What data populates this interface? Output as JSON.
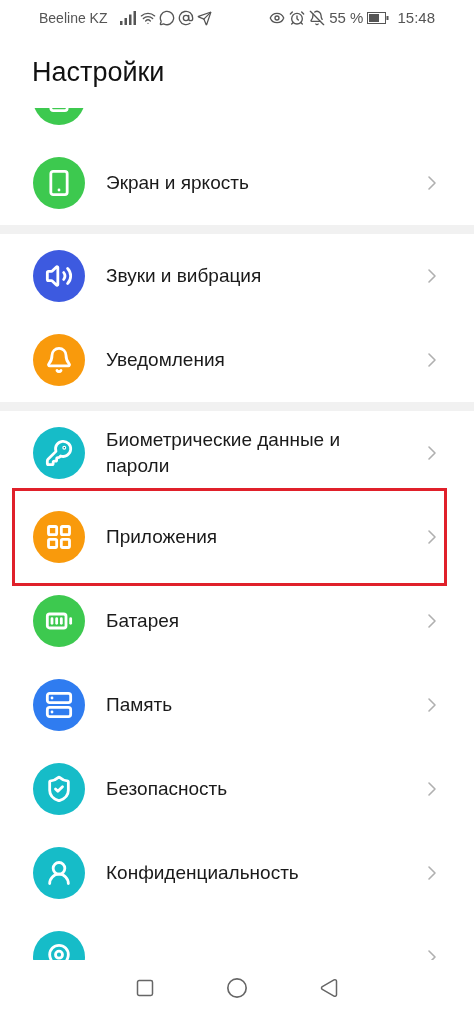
{
  "status_bar": {
    "carrier": "Beeline KZ",
    "battery": "55 %",
    "time": "15:48"
  },
  "title": "Настройки",
  "groups": [
    {
      "items": [
        {
          "color": "#3dc94f",
          "highlighted": false
        },
        {
          "label": "Экран и яркость",
          "color": "#3dc94f",
          "highlighted": false
        }
      ]
    },
    {
      "items": [
        {
          "label": "Звуки и вибрация",
          "color": "#3d5ae0",
          "highlighted": false
        },
        {
          "label": "Уведомления",
          "color": "#f99a0c",
          "highlighted": false
        }
      ]
    },
    {
      "items": [
        {
          "label": "Биометрические данные и пароли",
          "color": "#16bcc8",
          "highlighted": false
        },
        {
          "label": "Приложения",
          "color": "#f99a0c",
          "highlighted": true
        },
        {
          "label": "Батарея",
          "color": "#3dc94f",
          "highlighted": false
        },
        {
          "label": "Память",
          "color": "#2f7cf0",
          "highlighted": false
        },
        {
          "label": "Безопасность",
          "color": "#16bcc8",
          "highlighted": false
        },
        {
          "label": "Конфиденциальность",
          "color": "#16bcc8",
          "highlighted": false
        },
        {
          "color": "#16bcc8",
          "highlighted": false
        }
      ]
    }
  ]
}
